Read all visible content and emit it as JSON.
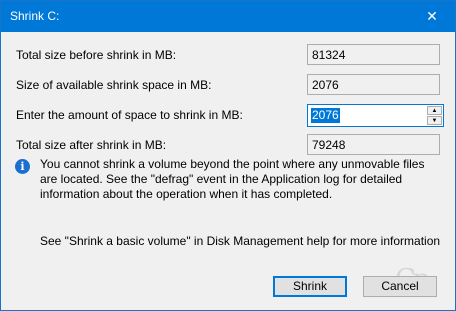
{
  "window": {
    "title": "Shrink C:",
    "close_glyph": "✕"
  },
  "fields": {
    "total_before": {
      "label": "Total size before shrink in MB:",
      "value": "81324"
    },
    "available": {
      "label": "Size of available shrink space in MB:",
      "value": "2076"
    },
    "amount": {
      "label": "Enter the amount of space to shrink in MB:",
      "value": "2076",
      "up_glyph": "▲",
      "down_glyph": "▼"
    },
    "total_after": {
      "label": "Total size after shrink in MB:",
      "value": "79248"
    }
  },
  "info": {
    "icon": "info-icon",
    "icon_glyph": "i",
    "text": "You cannot shrink a volume beyond the point where any unmovable files are located. See the \"defrag\" event in the Application log for detailed information about the operation when it has completed."
  },
  "help": {
    "text": "See \"Shrink a basic volume\" in Disk Management help for more information"
  },
  "buttons": {
    "shrink": "Shrink",
    "cancel": "Cancel"
  },
  "watermark": {
    "text": "Gp"
  },
  "colors": {
    "titlebar": "#0078d7",
    "accent": "#0078d7",
    "dialog_bg": "#f0f0f0"
  }
}
